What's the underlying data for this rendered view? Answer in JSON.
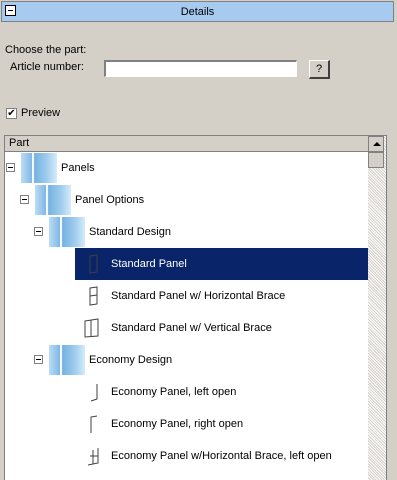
{
  "header": {
    "title": "Details"
  },
  "form": {
    "choose_label": "Choose the part:",
    "article_label": "Article number:",
    "article_value": "",
    "lookup_label": "?"
  },
  "preview": {
    "label": "Preview",
    "checked": true,
    "check_glyph": "✔"
  },
  "tree": {
    "column_header": "Part",
    "rows": [
      {
        "label": "Panels",
        "depth": 0,
        "type": "folder",
        "expanded": true
      },
      {
        "label": "Panel Options",
        "depth": 1,
        "type": "folder",
        "expanded": true
      },
      {
        "label": "Standard Design",
        "depth": 2,
        "type": "folder",
        "expanded": true
      },
      {
        "label": "Standard Panel",
        "depth": 3,
        "type": "item",
        "selected": true,
        "icon": "standard-panel-icon"
      },
      {
        "label": "Standard Panel w/ Horizontal Brace",
        "depth": 3,
        "type": "item",
        "icon": "horizontal-brace-panel-icon"
      },
      {
        "label": "Standard Panel w/ Vertical Brace",
        "depth": 3,
        "type": "item",
        "icon": "vertical-brace-panel-icon"
      },
      {
        "label": "Economy Design",
        "depth": 2,
        "type": "folder",
        "expanded": true
      },
      {
        "label": "Economy Panel, left open",
        "depth": 3,
        "type": "item",
        "icon": "economy-left-open-icon"
      },
      {
        "label": "Economy Panel, right open",
        "depth": 3,
        "type": "item",
        "icon": "economy-right-open-icon"
      },
      {
        "label": "Economy Panel w/Horizontal Brace, left open",
        "depth": 3,
        "type": "item",
        "icon": "economy-brace-left-open-icon"
      }
    ]
  },
  "colors": {
    "header_bg": "#a6caf0",
    "selection_bg": "#0a246a",
    "window_bg": "#d4d0c8"
  }
}
